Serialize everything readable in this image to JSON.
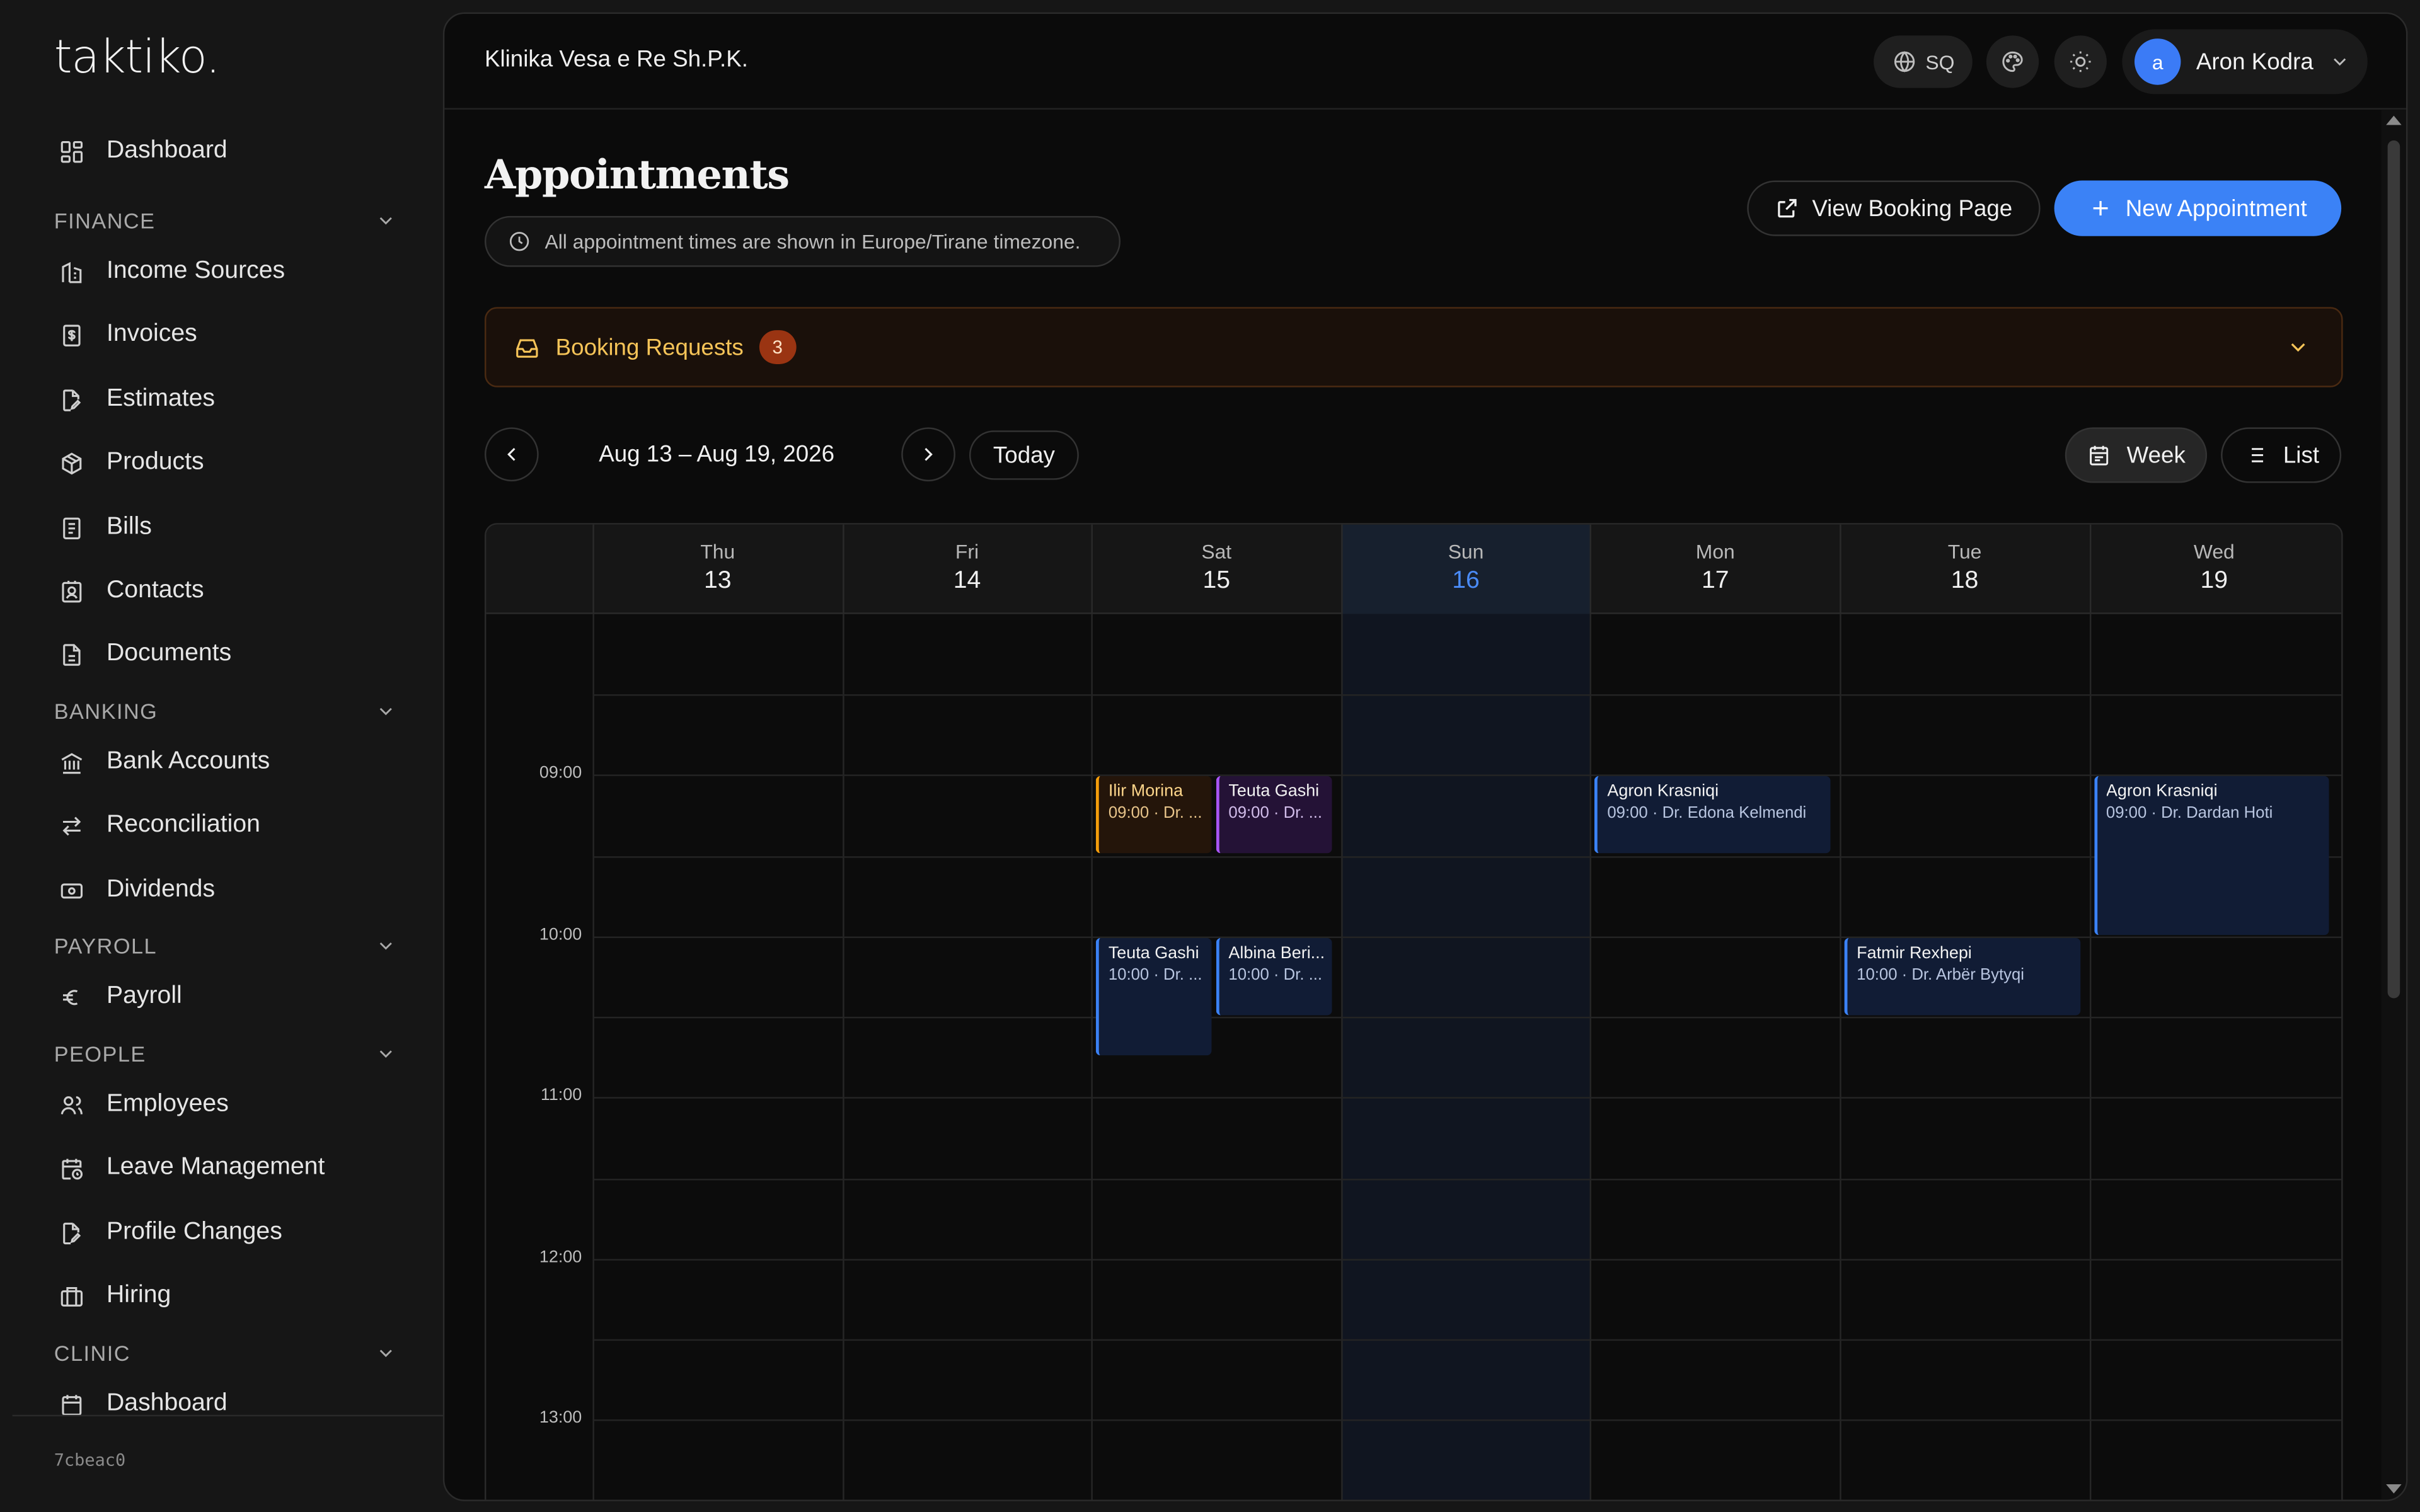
{
  "sidebar": {
    "logo": "taktiko.",
    "dashboard": "Dashboard",
    "sections": {
      "finance": "FINANCE",
      "banking": "BANKING",
      "payroll": "PAYROLL",
      "people": "PEOPLE",
      "clinic": "CLINIC"
    },
    "finance_items": [
      "Income Sources",
      "Invoices",
      "Estimates",
      "Products",
      "Bills",
      "Contacts",
      "Documents"
    ],
    "banking_items": [
      "Bank Accounts",
      "Reconciliation",
      "Dividends"
    ],
    "payroll_items": [
      "Payroll"
    ],
    "people_items": [
      "Employees",
      "Leave Management",
      "Profile Changes",
      "Hiring"
    ],
    "clinic_items": [
      "Dashboard"
    ],
    "commit": "7cbeac0"
  },
  "topbar": {
    "org": "Klinika Vesa e Re Sh.P.K.",
    "language": "SQ",
    "user_initial": "a",
    "user_name": "Aron Kodra"
  },
  "page": {
    "title": "Appointments",
    "timezone_note": "All appointment times are shown in Europe/Tirane timezone.",
    "view_booking": "View Booking Page",
    "new_appointment": "New Appointment"
  },
  "booking_requests": {
    "label": "Booking Requests",
    "count": "3"
  },
  "calendar": {
    "range": "Aug 13 – Aug 19, 2026",
    "today_label": "Today",
    "views": {
      "week": "Week",
      "list": "List"
    },
    "active_view": "week",
    "days": [
      {
        "name": "Thu",
        "date": "13"
      },
      {
        "name": "Fri",
        "date": "14"
      },
      {
        "name": "Sat",
        "date": "15"
      },
      {
        "name": "Sun",
        "date": "16",
        "today": true
      },
      {
        "name": "Mon",
        "date": "17"
      },
      {
        "name": "Tue",
        "date": "18"
      },
      {
        "name": "Wed",
        "date": "19"
      }
    ],
    "times": [
      "09:00",
      "10:00",
      "11:00",
      "12:00",
      "13:00"
    ],
    "events": [
      {
        "day": 2,
        "lane": 0,
        "lanes": 2,
        "start": "09:00",
        "hours": 0.5,
        "name": "Ilir Morina",
        "detail": "09:00 · Dr. ...",
        "color": "orange"
      },
      {
        "day": 2,
        "lane": 1,
        "lanes": 2,
        "start": "09:00",
        "hours": 0.5,
        "name": "Teuta Gashi",
        "detail": "09:00 · Dr. ...",
        "color": "purple"
      },
      {
        "day": 2,
        "lane": 0,
        "lanes": 2,
        "start": "10:00",
        "hours": 0.75,
        "name": "Teuta Gashi",
        "detail": "10:00 · Dr. ...",
        "color": "blue"
      },
      {
        "day": 2,
        "lane": 1,
        "lanes": 2,
        "start": "10:00",
        "hours": 0.5,
        "name": "Albina Beri...",
        "detail": "10:00 · Dr. ...",
        "color": "blue"
      },
      {
        "day": 4,
        "lane": 0,
        "lanes": 1,
        "start": "09:00",
        "hours": 0.5,
        "name": "Agron Krasniqi",
        "detail": "09:00 · Dr. Edona Kelmendi",
        "color": "blue"
      },
      {
        "day": 5,
        "lane": 0,
        "lanes": 1,
        "start": "10:00",
        "hours": 0.5,
        "name": "Fatmir Rexhepi",
        "detail": "10:00 · Dr. Arbër Bytyqi",
        "color": "blue"
      },
      {
        "day": 6,
        "lane": 0,
        "lanes": 1,
        "start": "09:00",
        "hours": 1,
        "name": "Agron Krasniqi",
        "detail": "09:00 · Dr. Dardan Hoti",
        "color": "blue"
      }
    ]
  }
}
